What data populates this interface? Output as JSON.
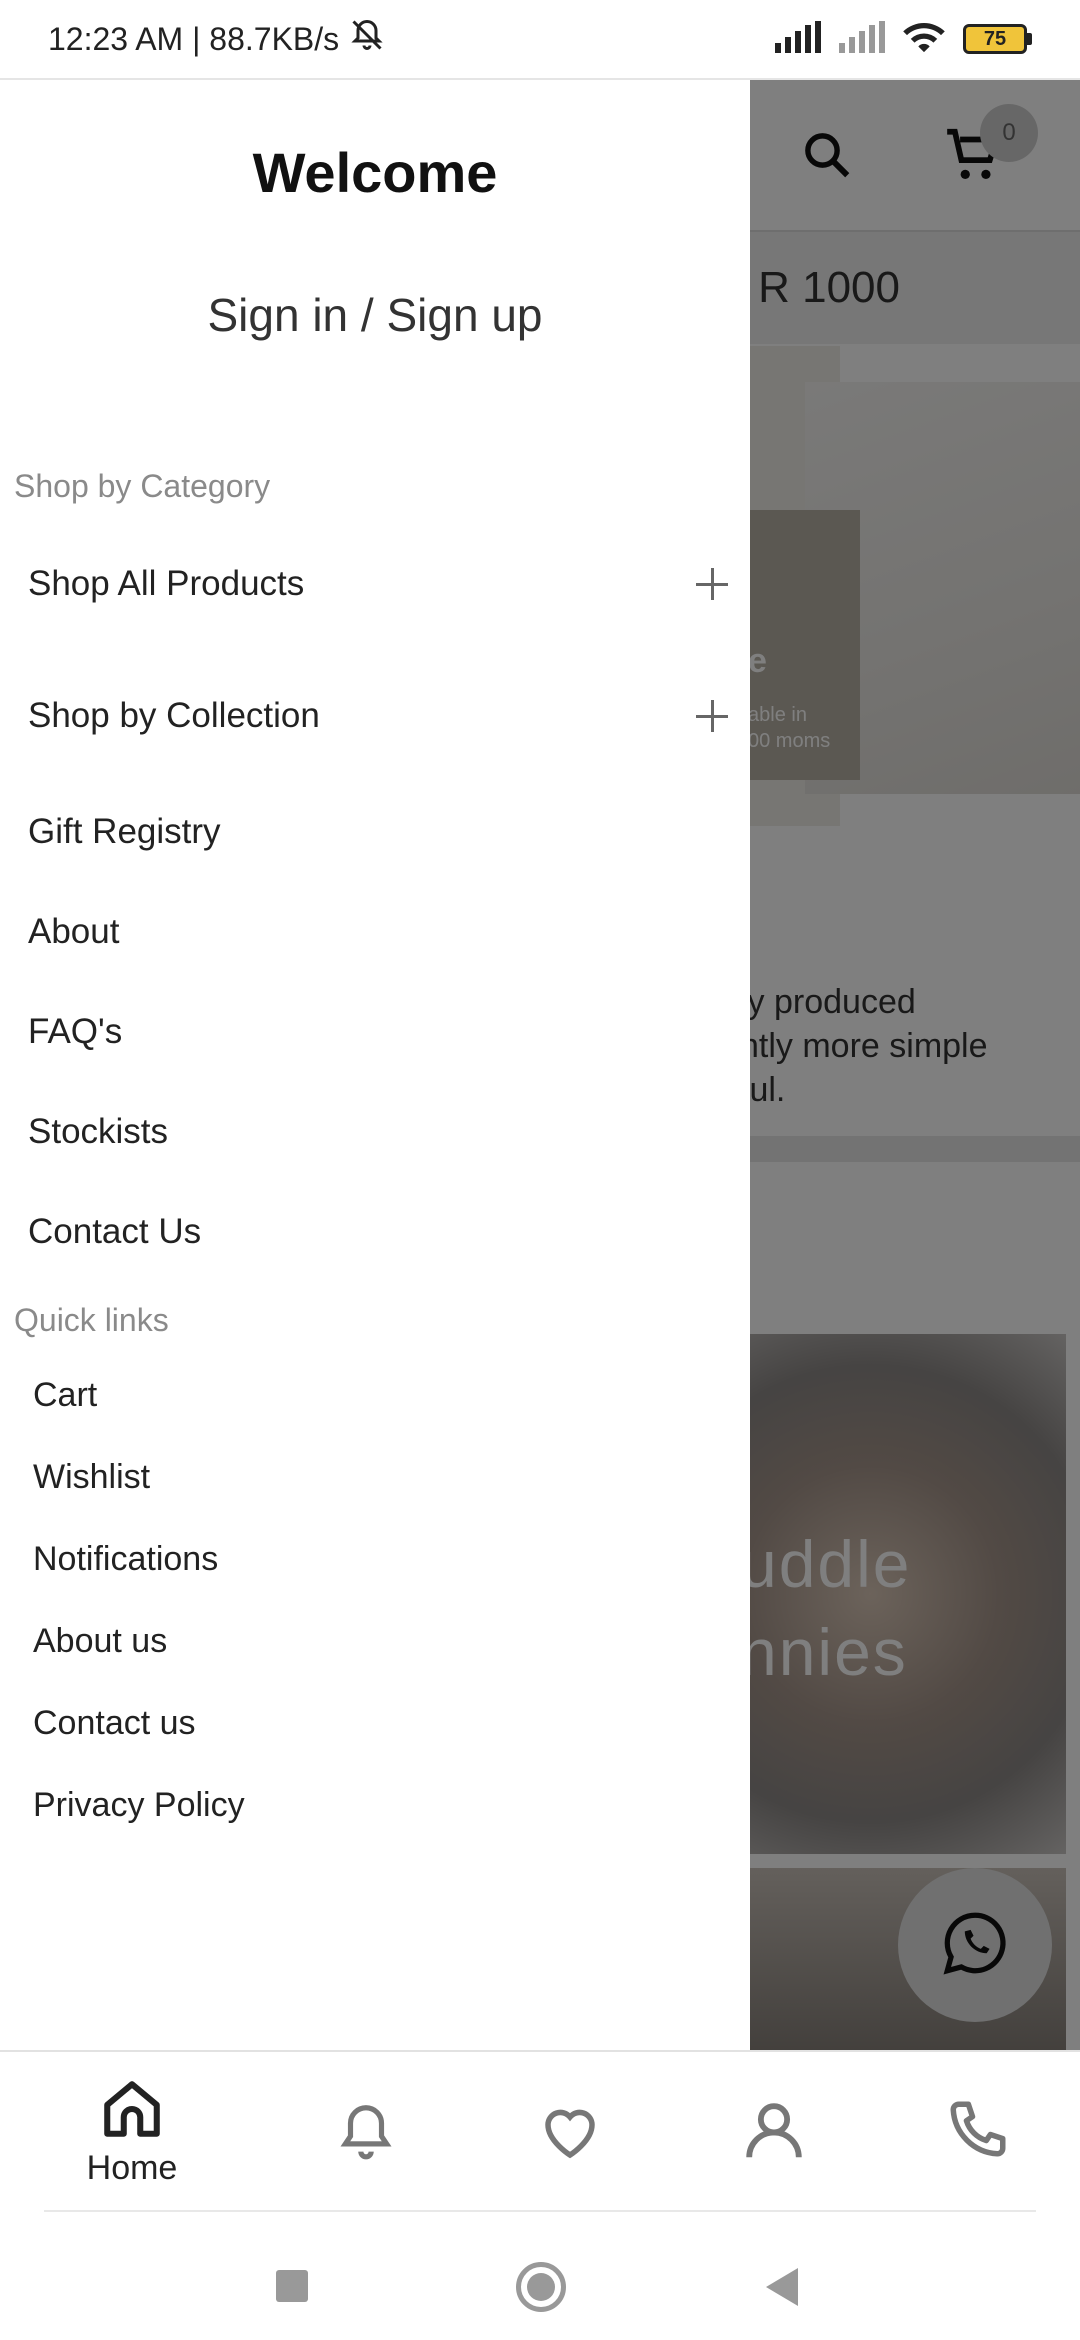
{
  "status_bar": {
    "time_speed": "12:23 AM | 88.7KB/s",
    "battery_level": "75"
  },
  "background": {
    "cart_count": "0",
    "promo_text": "r R 1000",
    "hero_title": "e",
    "hero_sub": "able in\n00 moms",
    "description": "ly produced\nntly more simple\nful.",
    "photo_text": "uddle\nnnies"
  },
  "drawer": {
    "title": "Welcome",
    "signin": "Sign in / Sign up",
    "category_label": "Shop by Category",
    "category_items": [
      {
        "label": "Shop All Products",
        "expandable": true
      },
      {
        "label": "Shop by Collection",
        "expandable": true
      },
      {
        "label": "Gift Registry",
        "expandable": false
      },
      {
        "label": "About",
        "expandable": false
      },
      {
        "label": "FAQ's",
        "expandable": false
      },
      {
        "label": "Stockists",
        "expandable": false
      },
      {
        "label": "Contact Us",
        "expandable": false
      }
    ],
    "quick_label": "Quick links",
    "quick_items": [
      "Cart",
      "Wishlist",
      "Notifications",
      "About us",
      "Contact us",
      "Privacy Policy"
    ]
  },
  "bottom_nav": {
    "home_label": "Home",
    "icons": [
      "home-icon",
      "bell-icon",
      "heart-icon",
      "user-icon",
      "phone-icon"
    ]
  },
  "colors": {
    "scrim": "#000000",
    "battery": "#f0c43a",
    "muted_label": "#8a8a8a"
  }
}
